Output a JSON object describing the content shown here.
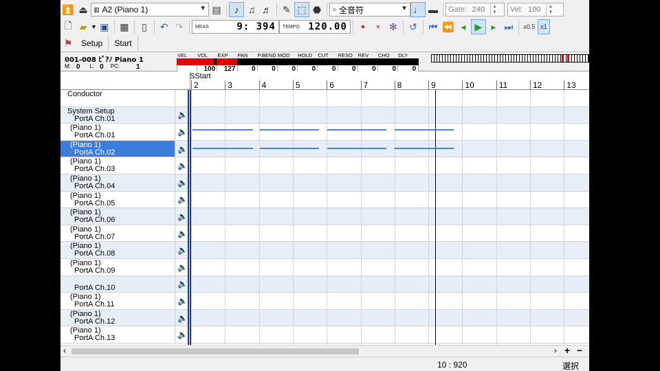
{
  "toolbar": {
    "track_select": "A2 (Piano 1)",
    "note_length": "全音符",
    "gate_label": "Gate:",
    "gate_value": "240",
    "vel_label": "Vel:",
    "vel_value": "100",
    "meas_label": "MEAS",
    "meas_value": "9: 394",
    "tempo_label": "TEMPO",
    "tempo_value": "120.00",
    "zoom_half": "x0.5",
    "zoom_one": "x1"
  },
  "tabs": {
    "setup": "Setup",
    "start": "Start"
  },
  "info": {
    "track_name": "001-008 ﾋﾟｱﾉ Piano 1",
    "m_label": "M:",
    "m_value": "0",
    "l_label": "L:",
    "l_value": "0",
    "pc_label": "PC:",
    "pc_value": "1",
    "meters": [
      {
        "label": "VEL",
        "value": "",
        "fill": 1.0
      },
      {
        "label": "VOL",
        "value": "100",
        "fill": 0.79
      },
      {
        "label": "EXP",
        "value": "127",
        "fill": 1.0
      },
      {
        "label": "PAN",
        "value": "0",
        "fill": 0
      },
      {
        "label": "P.BEND",
        "value": "0",
        "fill": 0
      },
      {
        "label": "MOD",
        "value": "0",
        "fill": 0
      },
      {
        "label": "HOLD",
        "value": "0",
        "fill": 0
      },
      {
        "label": "CUT",
        "value": "0",
        "fill": 0
      },
      {
        "label": "RESO",
        "value": "0",
        "fill": 0
      },
      {
        "label": "REV",
        "value": "0",
        "fill": 0
      },
      {
        "label": "CHO",
        "value": "0",
        "fill": 0
      },
      {
        "label": "DLY",
        "value": "0",
        "fill": 0
      }
    ]
  },
  "ruler": {
    "marker": "Start",
    "measures": [
      "2",
      "3",
      "4",
      "5",
      "6",
      "7",
      "8",
      "9",
      "10",
      "11",
      "12",
      "13"
    ]
  },
  "tracks": [
    {
      "line1": "Conductor",
      "line2": ""
    },
    {
      "line1": "System Setup",
      "line2": "PortA  Ch.01"
    },
    {
      "line1": "(Piano 1)",
      "line2": "PortA  Ch.01"
    },
    {
      "line1": "(Piano 1)",
      "line2": "PortA  Ch.02"
    },
    {
      "line1": "(Piano 1)",
      "line2": "PortA  Ch.03"
    },
    {
      "line1": "(Piano 1)",
      "line2": "PortA  Ch.04"
    },
    {
      "line1": "(Piano 1)",
      "line2": "PortA  Ch.05"
    },
    {
      "line1": "(Piano 1)",
      "line2": "PortA  Ch.06"
    },
    {
      "line1": "(Piano 1)",
      "line2": "PortA  Ch.07"
    },
    {
      "line1": "(Piano 1)",
      "line2": "PortA  Ch.08"
    },
    {
      "line1": "(Piano 1)",
      "line2": "PortA  Ch.09"
    },
    {
      "line1": "",
      "line2": "PortA  Ch.10"
    },
    {
      "line1": "(Piano 1)",
      "line2": "PortA  Ch.11"
    },
    {
      "line1": "(Piano 1)",
      "line2": "PortA  Ch.12"
    },
    {
      "line1": "(Piano 1)",
      "line2": "PortA  Ch.13"
    }
  ],
  "selected_track": 3,
  "status": {
    "position": "10 : 920",
    "mode": "選択"
  },
  "colors": {
    "selection": "#3b7ddc",
    "note": "#2a6ed8",
    "meter_fill": "#e00000"
  }
}
